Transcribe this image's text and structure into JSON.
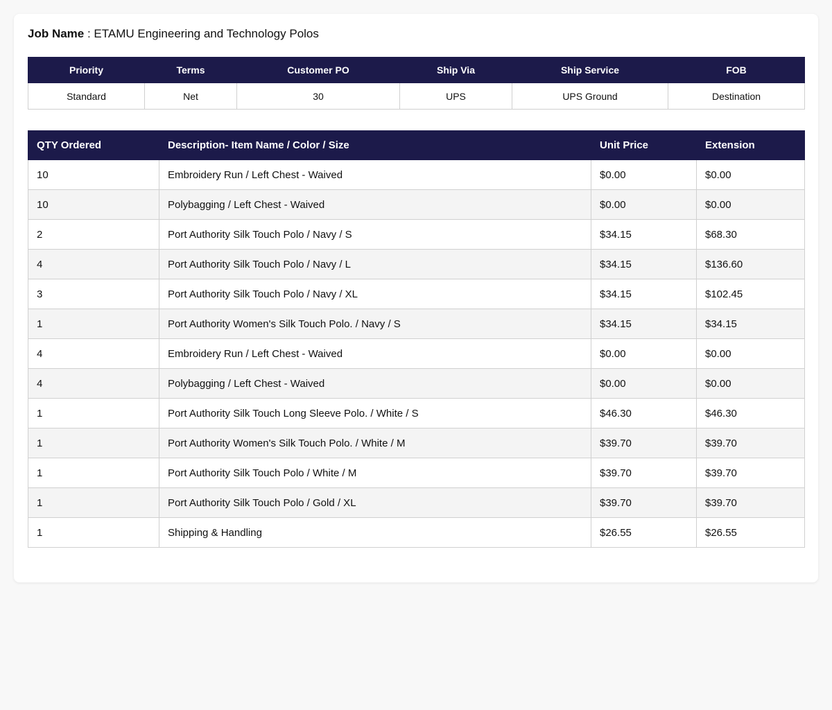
{
  "job": {
    "label": "Job Name",
    "separator": " : ",
    "value": "ETAMU Engineering and Technology Polos"
  },
  "meta": {
    "headers": [
      "Priority",
      "Terms",
      "Customer PO",
      "Ship Via",
      "Ship Service",
      "FOB"
    ],
    "values": [
      "Standard",
      "Net",
      "30",
      "UPS",
      "UPS Ground",
      "Destination"
    ]
  },
  "items": {
    "headers": [
      "QTY Ordered",
      "Description- Item Name / Color / Size",
      "Unit Price",
      "Extension"
    ],
    "rows": [
      [
        "10",
        "Embroidery Run / Left Chest - Waived",
        "$0.00",
        "$0.00"
      ],
      [
        "10",
        "Polybagging / Left Chest - Waived",
        "$0.00",
        "$0.00"
      ],
      [
        "2",
        "Port Authority Silk Touch Polo / Navy / S",
        "$34.15",
        "$68.30"
      ],
      [
        "4",
        "Port Authority Silk Touch Polo / Navy / L",
        "$34.15",
        "$136.60"
      ],
      [
        "3",
        "Port Authority Silk Touch Polo / Navy / XL",
        "$34.15",
        "$102.45"
      ],
      [
        "1",
        "Port Authority Women's Silk Touch Polo. / Navy / S",
        "$34.15",
        "$34.15"
      ],
      [
        "4",
        "Embroidery Run / Left Chest - Waived",
        "$0.00",
        "$0.00"
      ],
      [
        "4",
        "Polybagging / Left Chest - Waived",
        "$0.00",
        "$0.00"
      ],
      [
        "1",
        "Port Authority Silk Touch Long Sleeve Polo. / White / S",
        "$46.30",
        "$46.30"
      ],
      [
        "1",
        "Port Authority Women's Silk Touch Polo. / White / M",
        "$39.70",
        "$39.70"
      ],
      [
        "1",
        "Port Authority Silk Touch Polo / White / M",
        "$39.70",
        "$39.70"
      ],
      [
        "1",
        "Port Authority Silk Touch Polo / Gold / XL",
        "$39.70",
        "$39.70"
      ],
      [
        "1",
        "Shipping & Handling",
        "$26.55",
        "$26.55"
      ]
    ]
  },
  "colors": {
    "header_bg": "#1c1a4a",
    "header_text": "#ffffff",
    "row_alt_bg": "#f4f4f4",
    "page_bg": "#f8f8f8"
  }
}
